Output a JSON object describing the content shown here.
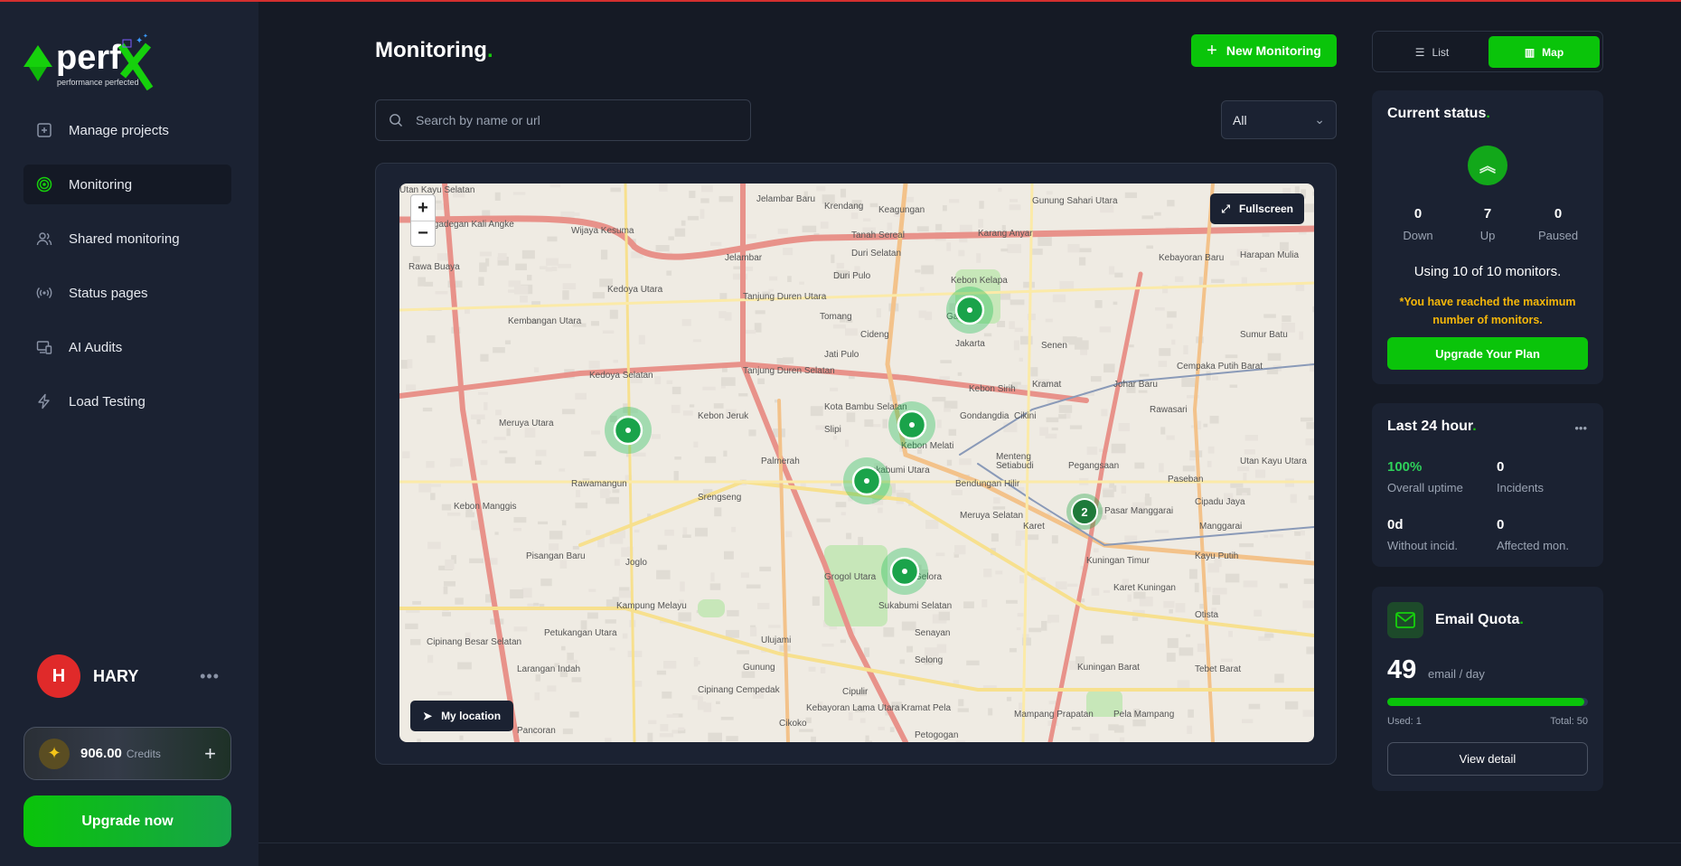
{
  "brand": {
    "name": "perfx",
    "tagline": "performance perfected",
    "badge": "AI"
  },
  "sidebar": {
    "items": [
      {
        "label": "Manage projects",
        "icon": "plus-square-icon"
      },
      {
        "label": "Monitoring",
        "icon": "target-icon",
        "active": true
      },
      {
        "label": "Shared monitoring",
        "icon": "users-icon"
      },
      {
        "label": "Status pages",
        "icon": "broadcast-icon"
      },
      {
        "label": "AI Audits",
        "icon": "devices-icon"
      },
      {
        "label": "Load Testing",
        "icon": "lightning-icon"
      }
    ],
    "user": {
      "initial": "H",
      "name": "HARY",
      "menu": "•••"
    },
    "credits": {
      "value": "906.00",
      "label": "Credits",
      "add": "+"
    },
    "upgrade_label": "Upgrade now"
  },
  "header": {
    "title": "Monitoring",
    "title_dot": ".",
    "new_button": "New Monitoring"
  },
  "search": {
    "placeholder": "Search by name or url",
    "value": ""
  },
  "filter": {
    "selected": "All"
  },
  "map": {
    "zoom_in": "+",
    "zoom_out": "−",
    "fullscreen": "Fullscreen",
    "my_location": "My location",
    "cluster_count": "2",
    "labels": [
      "Jelambar Baru",
      "Krendang",
      "Keagungan",
      "Gunung Sahari Utara",
      "Pengadegan Kali Angke",
      "Wijaya Kesuma",
      "Tanah Sereal",
      "Karang Anyar",
      "Rawa Buaya",
      "Jelambar",
      "Duri Selatan",
      "Duri Pulo",
      "Kedoya Utara",
      "Tanjung Duren Utara",
      "Tomang",
      "Cideng",
      "Gambir",
      "Jakarta",
      "Senen",
      "Kembangan Utara",
      "Kedoya Selatan",
      "Tanjung Duren Selatan",
      "Jati Pulo",
      "Kebon Kelapa",
      "Kebon Sirih",
      "Kramat",
      "Johar Baru",
      "Cempaka Putih Barat",
      "Kebon Jeruk",
      "Kota Bambu Selatan",
      "Kebon Melati",
      "Gondangdia",
      "Cikini",
      "Rawasari",
      "Meruya Utara",
      "Slipi",
      "Palmerah",
      "Menteng",
      "Paseban",
      "Utan Kayu Utara",
      "Rawamangun",
      "Srengseng",
      "Sukabumi Utara",
      "Bendungan Hilir",
      "Setiabudi",
      "Pegangsaan",
      "Kebon Manggis",
      "Meruya Selatan",
      "Karet",
      "Pasar Manggarai",
      "Manggarai",
      "Pisangan Baru",
      "Joglo",
      "Grogol Utara",
      "Gelora",
      "Karet Kuningan",
      "Kampung Melayu",
      "Sukabumi Selatan",
      "Senayan",
      "Kuningan Timur",
      "Otista",
      "Cipinang Besar Selatan",
      "Petukangan Utara",
      "Larangan Indah",
      "Ulujami",
      "Gunung",
      "Selong",
      "Kuningan Barat",
      "Tebet Barat",
      "Cipinang Cempedak",
      "Cipulir",
      "Kebayoran Lama Utara",
      "Kramat Pela",
      "Petogogan",
      "Mampang Prapatan",
      "Pela Mampang",
      "Pancoran",
      "Cikoko",
      "Cipadu Jaya",
      "Kebayoran Baru",
      "Harapan Mulia",
      "Sumur Batu",
      "Kayu Putih",
      "Utan Kayu Selatan"
    ]
  },
  "view_toggle": {
    "list": "List",
    "map": "Map",
    "active": "map"
  },
  "current_status": {
    "title": "Current status",
    "down": "0",
    "down_label": "Down",
    "up": "7",
    "up_label": "Up",
    "paused": "0",
    "paused_label": "Paused",
    "usage": "Using 10 of 10 monitors.",
    "warning": "*You have reached the maximum number of monitors.",
    "upgrade": "Upgrade Your Plan"
  },
  "last24": {
    "title": "Last 24 hour",
    "menu": "•••",
    "uptime": "100%",
    "uptime_label": "Overall uptime",
    "incidents": "0",
    "incidents_label": "Incidents",
    "without": "0d",
    "without_label": "Without incid.",
    "affected": "0",
    "affected_label": "Affected mon."
  },
  "email_quota": {
    "title": "Email Quota",
    "remaining": "49",
    "unit": "email / day",
    "used_label": "Used: 1",
    "total_label": "Total: 50",
    "used_fraction": 0.02,
    "view": "View detail"
  },
  "colors": {
    "accent": "#0ac40a",
    "warning": "#f5b70a",
    "avatar": "#e02a2a",
    "sidebar": "#1b2232",
    "background": "#151a25"
  }
}
